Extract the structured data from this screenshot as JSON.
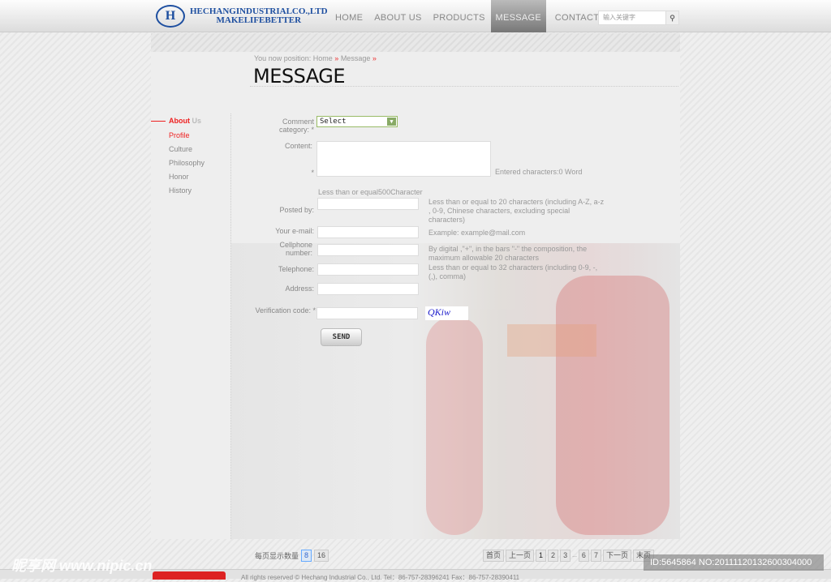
{
  "header": {
    "logo_mark": "H",
    "logo_line1": "HECHANGINDUSTRIALCO.,LTD",
    "logo_line2": "MAKELIFEBETTER",
    "nav": [
      {
        "label": "HOME"
      },
      {
        "label": "ABOUT US"
      },
      {
        "label": "PRODUCTS"
      },
      {
        "label": "MESSAGE",
        "active": true
      },
      {
        "label": "CONTACT"
      }
    ],
    "search_placeholder": "输入关键字",
    "search_icon": "magnifier-icon"
  },
  "breadcrumb": {
    "prefix": "You now position:",
    "home": "Home",
    "sep": "»",
    "current": "Message"
  },
  "page_title": "MESSAGE",
  "sidebar": {
    "heading_main": "About",
    "heading_sub": " Us",
    "items": [
      {
        "label": "Profile",
        "active": true
      },
      {
        "label": "Culture"
      },
      {
        "label": "Philosophy"
      },
      {
        "label": "Honor"
      },
      {
        "label": "History"
      }
    ]
  },
  "form": {
    "category_label": "Comment category: *",
    "category_value": "Select",
    "content_label": "Content:",
    "content_star": "*",
    "content_counter": "Entered characters:0 Word",
    "content_limit": "Less than or equal500Character",
    "posted_label": "Posted by:",
    "posted_hint": "Less than or equal to 20 characters (including A-Z, a-z , 0-9, Chinese characters, excluding special characters)",
    "email_label": "Your e-mail:",
    "email_hint": "Example: example@mail.com",
    "cell_label": "Cellphone number:",
    "cell_hint": "By digital ,\"+\", in the bars \"-\" the composition, the maximum allowable 20 characters",
    "tel_label": "Telephone:",
    "tel_hint": "Less than or equal to 32 characters (including 0-9, -, (,), comma)",
    "address_label": "Address:",
    "verify_label": "Verification code: *",
    "captcha": "QKiw",
    "send": "SEND"
  },
  "page_size": {
    "label": "每页显示数量",
    "options": [
      "8",
      "16"
    ],
    "selected": "8"
  },
  "pager": {
    "first": "首页",
    "prev": "上一页",
    "pages": [
      "1",
      "2",
      "3"
    ],
    "ellipsis": "...",
    "pages2": [
      "6",
      "7"
    ],
    "next": "下一页",
    "last": "末页"
  },
  "footer": {
    "text": "All rights reserved © Hechang Industrial Co., Ltd.    Tel：86-757-28396241    Fax：86-757-28390411"
  },
  "watermark": {
    "site": "昵享网 www.nipic.cn",
    "id": "ID:5645864 NO:20111120132600304000"
  }
}
